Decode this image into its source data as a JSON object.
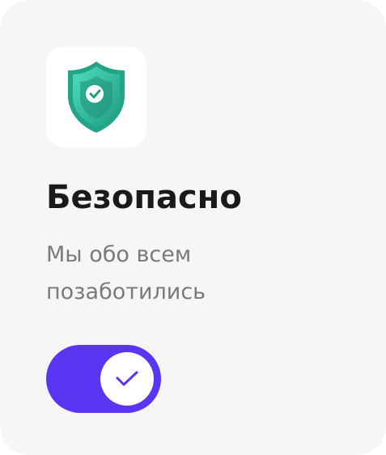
{
  "card": {
    "title": "Безопасно",
    "subtitle": "Мы обо всем позаботились"
  },
  "icon": {
    "name": "shield-check-icon",
    "colors": {
      "shield_light": "#3ccfae",
      "shield_dark": "#1f9c82",
      "check": "#ffffff"
    }
  },
  "toggle": {
    "state": "on",
    "track_color": "#5b36f2",
    "knob_icon": "check-icon"
  },
  "colors": {
    "card_background": "#f6f6f6",
    "title": "#1a1a1a",
    "subtitle": "#7a7a7a"
  }
}
